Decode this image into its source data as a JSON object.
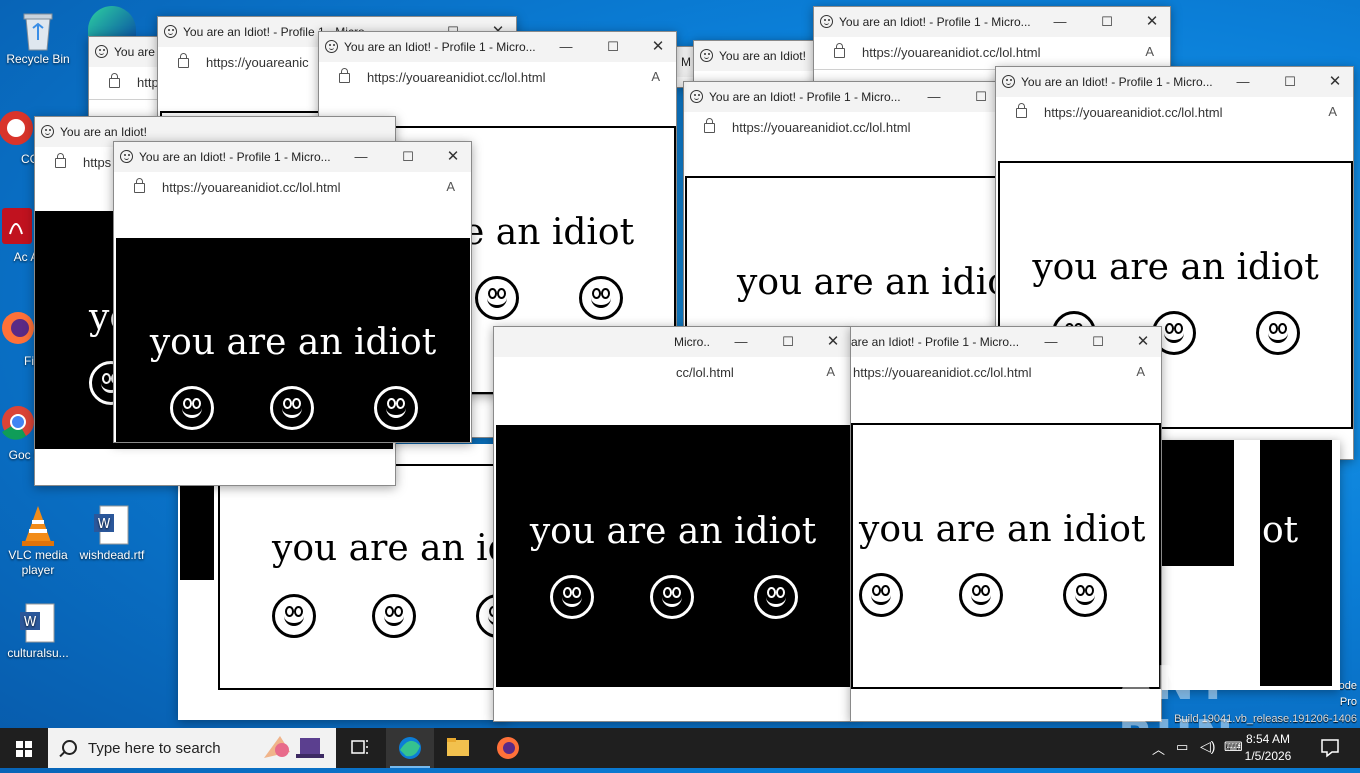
{
  "desktop": {
    "icons": [
      {
        "label": "Recycle Bin"
      },
      {
        "label": "CCl"
      },
      {
        "label": "Ac Acr"
      },
      {
        "label": "Fir"
      },
      {
        "label": "Goc Chr"
      },
      {
        "label": "VLC media player"
      },
      {
        "label": "wishdead.rtf"
      },
      {
        "label": "culturalsu..."
      }
    ],
    "build_info": [
      "ode",
      "Pro",
      "Build 19041.vb_release.191206-1406"
    ],
    "watermark": "ANY RUN"
  },
  "popup": {
    "title_full": "You are an Idiot! - Profile 1 - Micro...",
    "title_short": "You are an Idiot!",
    "title_mid": "You are an Idiot! - Profile 1 - Micro",
    "title_a": "You are a",
    "title_partial": "are an Idiot! - Profile 1 - Micro...",
    "title_micro": "Micro...",
    "title_m": "M",
    "url": "https://youareanidiot.cc/lol.html",
    "url_short1": "https://youareanic",
    "url_short2": "http",
    "url_short3": "https",
    "url_tail": "cc/lol.html",
    "message": "you are an idiot",
    "message_a": "you are an idi",
    "message_b": "yo",
    "message_c": "e an idiot",
    "message_d": "ot"
  },
  "taskbar": {
    "search_placeholder": "Type here to search",
    "time": "8:54 AM",
    "date": "1/5/2026"
  },
  "colors": {
    "accent": "#0078d7",
    "taskbar": "#1f1f1f"
  }
}
